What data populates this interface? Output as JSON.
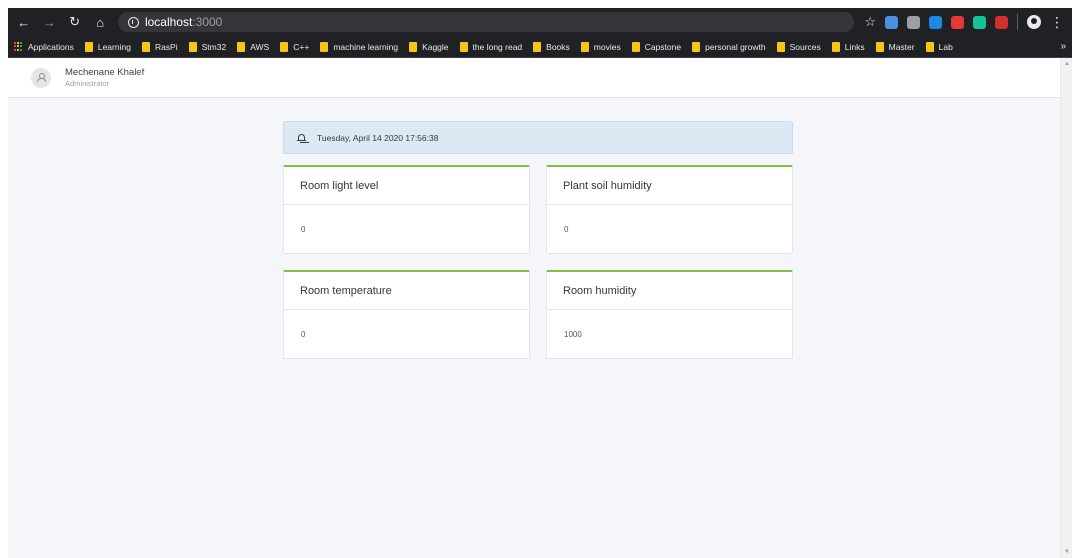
{
  "browser": {
    "url_host": "localhost",
    "url_port": ":3000",
    "bookmarks": [
      "Applications",
      "Learning",
      "RasPi",
      "Stm32",
      "AWS",
      "C++",
      "machine learning",
      "Kaggle",
      "the long read",
      "Books",
      "movies",
      "Capstone",
      "personal growth",
      "Sources",
      "Links",
      "Master",
      "Lab"
    ],
    "bookmarks_overflow": "»",
    "extension_colors": [
      "#4a90e2",
      "#9aa0a6",
      "#1e88e5",
      "#e53935",
      "#15c39a",
      "#d32f2f"
    ]
  },
  "header": {
    "user_name": "Mechenane Khalef",
    "user_role": "Administrator"
  },
  "alert": {
    "datetime": "Tuesday, April 14 2020 17:56:38"
  },
  "sensors": [
    {
      "title": "Room light level",
      "value": "0"
    },
    {
      "title": "Plant soil humidity",
      "value": "0"
    },
    {
      "title": "Room temperature",
      "value": "0"
    },
    {
      "title": "Room humidity",
      "value": "1000"
    }
  ],
  "colors": {
    "card_accent": "#7ec242",
    "alert_bg": "#dde8f5",
    "page_bg": "#f5f6f9"
  }
}
